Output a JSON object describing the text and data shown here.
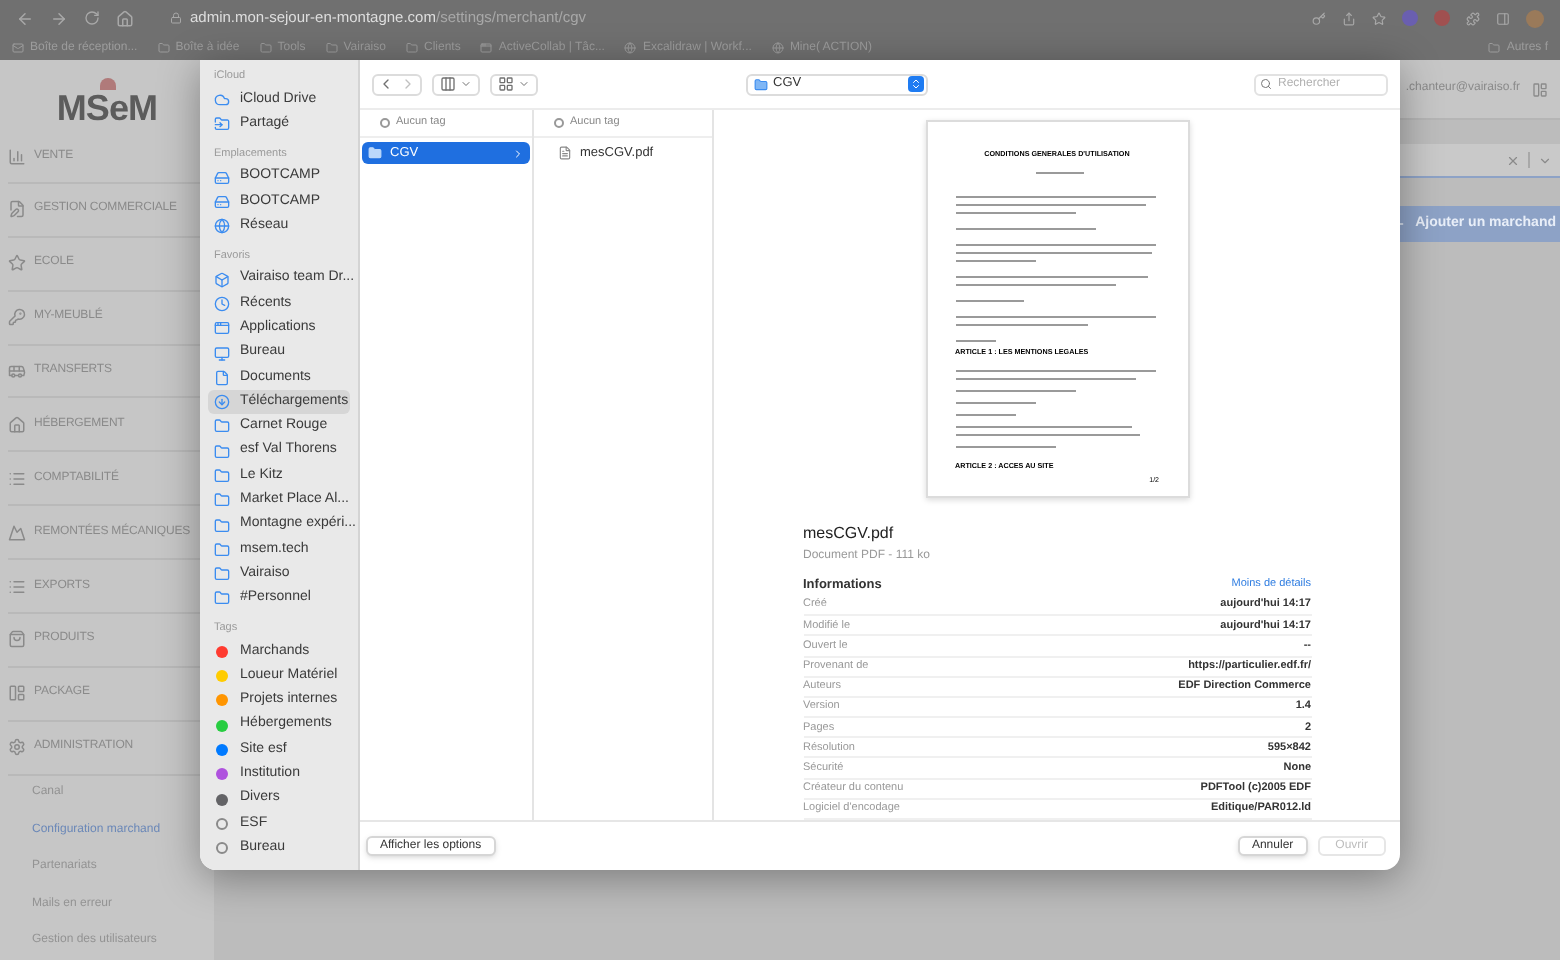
{
  "browser": {
    "url_host": "admin.mon-sejour-en-montagne.com",
    "url_path": "/settings/merchant/cgv",
    "bookmarks": [
      {
        "label": "Boîte de réception...",
        "kind": "mail"
      },
      {
        "label": "Boîte à idée",
        "kind": "folder"
      },
      {
        "label": "Tools",
        "kind": "folder"
      },
      {
        "label": "Vairaiso",
        "kind": "folder"
      },
      {
        "label": "Clients",
        "kind": "folder"
      },
      {
        "label": "ActiveCollab | Tâc...",
        "kind": "app"
      },
      {
        "label": "Excalidraw | Workf...",
        "kind": "globe"
      },
      {
        "label": "Mine( ACTION)",
        "kind": "globe"
      }
    ],
    "other_bookmarks": "Autres f"
  },
  "app_sidebar": {
    "logo": "MSeM",
    "items": [
      {
        "label": "VENTE"
      },
      {
        "label": "GESTION COMMERCIALE"
      },
      {
        "label": "ECOLE"
      },
      {
        "label": "MY-MEUBLÉ"
      },
      {
        "label": "TRANSFERTS"
      },
      {
        "label": "HÉBERGEMENT"
      },
      {
        "label": "COMPTABILITÉ"
      },
      {
        "label": "REMONTÉES MÉCANIQUES"
      },
      {
        "label": "EXPORTS"
      },
      {
        "label": "PRODUITS"
      },
      {
        "label": "PACKAGE"
      },
      {
        "label": "ADMINISTRATION"
      }
    ],
    "sub_items": [
      {
        "label": "Canal",
        "selected": false
      },
      {
        "label": "Configuration marchand",
        "selected": true
      },
      {
        "label": "Partenariats",
        "selected": false
      },
      {
        "label": "Mails en erreur",
        "selected": false
      },
      {
        "label": "Gestion des utilisateurs",
        "selected": false
      }
    ]
  },
  "header": {
    "user_email": ".chanteur@vairaiso.fr"
  },
  "add_button": {
    "label": "Ajouter un marchand"
  },
  "dialog": {
    "toolbar": {
      "location": "CGV",
      "search_placeholder": "Rechercher"
    },
    "sidebar": [
      {
        "title": "iCloud",
        "items": [
          {
            "label": "iCloud Drive",
            "kind": "cloud",
            "selected": false
          },
          {
            "label": "Partagé",
            "kind": "shared",
            "selected": false
          }
        ]
      },
      {
        "title": "Emplacements",
        "items": [
          {
            "label": "BOOTCAMP",
            "kind": "disk",
            "selected": false
          },
          {
            "label": "BOOTCAMP",
            "kind": "disk",
            "selected": false
          },
          {
            "label": "Réseau",
            "kind": "network",
            "selected": false
          }
        ]
      },
      {
        "title": "Favoris",
        "items": [
          {
            "label": "Vairaiso team Dr...",
            "kind": "dropbox",
            "selected": false
          },
          {
            "label": "Récents",
            "kind": "recent",
            "selected": false
          },
          {
            "label": "Applications",
            "kind": "apps",
            "selected": false
          },
          {
            "label": "Bureau",
            "kind": "desktop",
            "selected": false
          },
          {
            "label": "Documents",
            "kind": "document",
            "selected": false
          },
          {
            "label": "Téléchargements",
            "kind": "download",
            "selected": true
          },
          {
            "label": "Carnet Rouge",
            "kind": "folder",
            "selected": false
          },
          {
            "label": "esf Val Thorens",
            "kind": "folder",
            "selected": false
          },
          {
            "label": "Le Kitz",
            "kind": "folder",
            "selected": false
          },
          {
            "label": "Market Place Al...",
            "kind": "folder",
            "selected": false
          },
          {
            "label": "Montagne expéri...",
            "kind": "folder",
            "selected": false
          },
          {
            "label": "msem.tech",
            "kind": "folder",
            "selected": false
          },
          {
            "label": "Vairaiso",
            "kind": "folder",
            "selected": false
          },
          {
            "label": "#Personnel",
            "kind": "folder",
            "selected": false
          }
        ]
      },
      {
        "title": "Tags",
        "items": [
          {
            "label": "Marchands",
            "kind": "tag",
            "color": "#ff3b30",
            "selected": false
          },
          {
            "label": "Loueur Matériel",
            "kind": "tag",
            "color": "#ffcc00",
            "selected": false
          },
          {
            "label": "Projets internes",
            "kind": "tag",
            "color": "#ff9500",
            "selected": false
          },
          {
            "label": "Hébergements",
            "kind": "tag",
            "color": "#28cd41",
            "selected": false
          },
          {
            "label": "Site esf",
            "kind": "tag",
            "color": "#007aff",
            "selected": false
          },
          {
            "label": "Institution",
            "kind": "tag",
            "color": "#af52de",
            "selected": false
          },
          {
            "label": "Divers",
            "kind": "tag",
            "color": "#636366",
            "selected": false
          },
          {
            "label": "ESF",
            "kind": "empty-tag",
            "selected": false
          },
          {
            "label": "Bureau",
            "kind": "empty-tag",
            "selected": false
          }
        ]
      }
    ],
    "columns": [
      {
        "tag_label": "Aucun tag",
        "items": [
          {
            "name": "CGV",
            "kind": "folder",
            "selected": true
          }
        ]
      },
      {
        "tag_label": "Aucun tag",
        "items": [
          {
            "name": "mesCGV.pdf",
            "kind": "file",
            "selected": false
          }
        ]
      }
    ],
    "preview": {
      "doc_title": "CONDITIONS GENERALES D'UTILISATION",
      "doc_headings": [
        "ARTICLE 1 : LES MENTIONS LEGALES",
        "ARTICLE 2 : ACCES AU SITE"
      ],
      "page_number": "1/2",
      "filename": "mesCGV.pdf",
      "subtitle": "Document PDF - 111 ko",
      "info_title": "Informations",
      "less_details": "Moins de détails",
      "rows": [
        {
          "label": "Créé",
          "value": "aujourd'hui 14:17"
        },
        {
          "label": "Modifié le",
          "value": "aujourd'hui 14:17"
        },
        {
          "label": "Ouvert le",
          "value": "--"
        },
        {
          "label": "Provenant de",
          "value": "https://particulier.edf.fr/"
        },
        {
          "label": "Auteurs",
          "value": "EDF Direction Commerce"
        },
        {
          "label": "Version",
          "value": "1.4"
        },
        {
          "label": "Pages",
          "value": "2"
        },
        {
          "label": "Résolution",
          "value": "595×842"
        },
        {
          "label": "Sécurité",
          "value": "None"
        },
        {
          "label": "Créateur du contenu",
          "value": "PDFTool (c)2005 EDF"
        },
        {
          "label": "Logiciel d'encodage",
          "value": "Editique/PAR012.ld"
        }
      ]
    },
    "footer": {
      "options_button": "Afficher les options",
      "cancel_button": "Annuler",
      "open_button": {
        "label": "Ouvrir",
        "disabled": true
      }
    }
  }
}
